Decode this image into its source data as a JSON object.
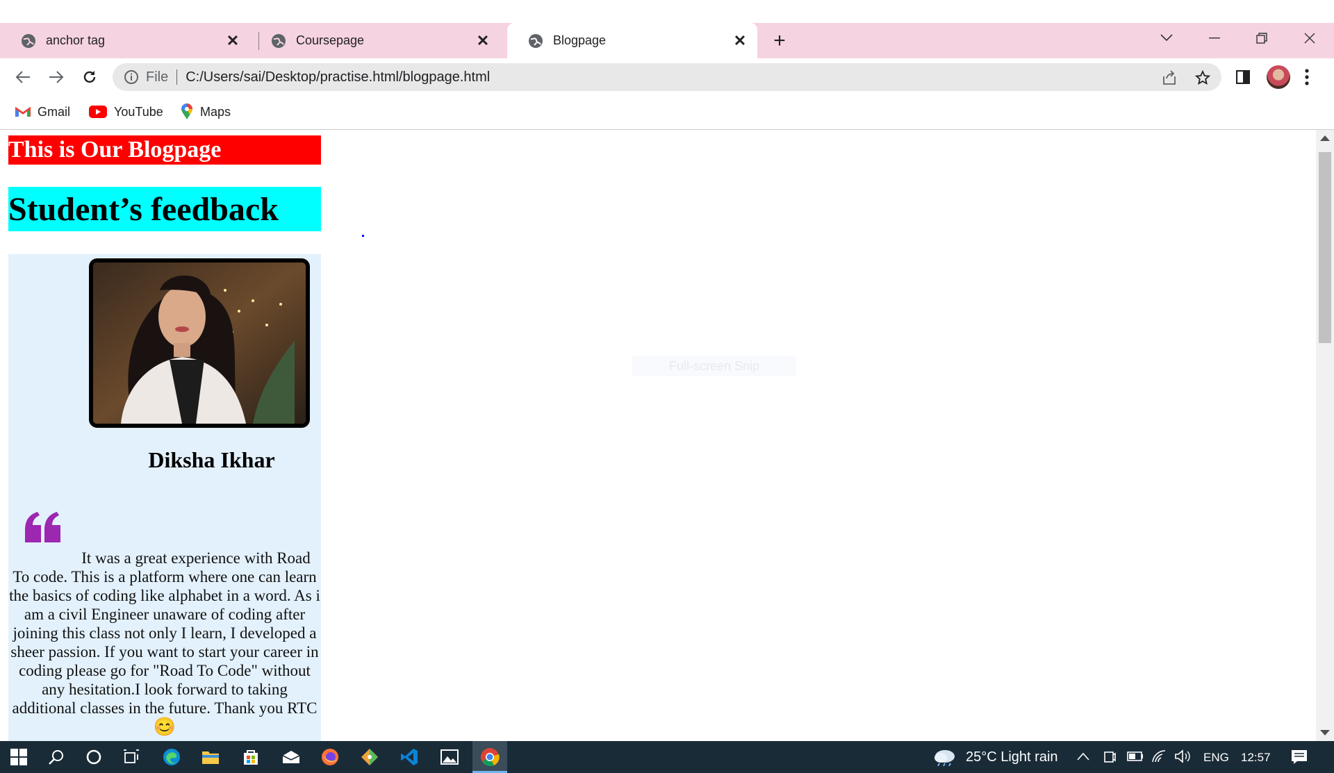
{
  "browser": {
    "tabs": [
      {
        "title": "anchor tag",
        "active": false
      },
      {
        "title": "Coursepage",
        "active": false
      },
      {
        "title": "Blogpage",
        "active": true
      }
    ],
    "address": {
      "scheme_label": "File",
      "url": "C:/Users/sai/Desktop/practise.html/blogpage.html"
    },
    "bookmarks": [
      {
        "label": "Gmail",
        "icon": "gmail-icon"
      },
      {
        "label": "YouTube",
        "icon": "youtube-icon"
      },
      {
        "label": "Maps",
        "icon": "maps-icon"
      }
    ]
  },
  "page": {
    "heading": "This is Our Blogpage",
    "subheading": "Student’s feedback",
    "student_name": "Diksha Ikhar",
    "feedback_lead": "It was a great experience with Road",
    "feedback_rest": "To code. This is a platform where one can learn the basics of coding like alphabet in a word. As i am a civil Engineer unaware of coding after joining this class not only I learn, I developed a sheer passion. If you want to start your career in coding please go for \"Road To Code\" without any hesitation.I look forward to taking additional classes in the future. Thank you RTC",
    "emoji": "😊",
    "snip_overlay": "Full-screen Snip"
  },
  "taskbar": {
    "weather": "25°C  Light rain",
    "language": "ENG",
    "time": "12:57"
  },
  "colors": {
    "heading_bg": "#ff0000",
    "subheading_bg": "#00ffff",
    "card_bg": "#e3f1fc",
    "quote": "#9c27b0",
    "tabbar": "#f6d3e1",
    "taskbar": "#1a2b38"
  }
}
